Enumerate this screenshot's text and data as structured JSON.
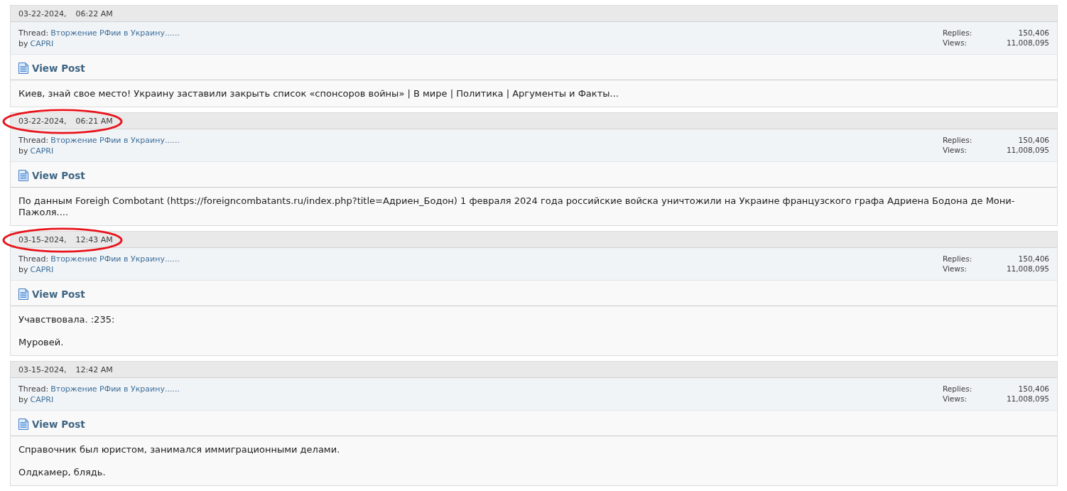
{
  "posts": [
    {
      "date": "03-22-2024,",
      "time": "06:22 AM",
      "circled": false,
      "thread_label": "Thread:",
      "thread_title": "Вторжение РФии в Украину......",
      "by_label": "by",
      "author": "CAPRI",
      "stats": [
        {
          "label": "Replies:",
          "value": "150,406"
        },
        {
          "label": "Views:",
          "value": "11,008,095"
        }
      ],
      "view_post": "View Post",
      "body": [
        "Киев, знай свое место! Украину заставили закрыть список «спонсоров войны» | В мире | Политика | Аргументы и Факты..."
      ]
    },
    {
      "date": "03-22-2024,",
      "time": "06:21 AM",
      "circled": true,
      "thread_label": "Thread:",
      "thread_title": "Вторжение РФии в Украину......",
      "by_label": "by",
      "author": "CAPRI",
      "stats": [
        {
          "label": "Replies:",
          "value": "150,406"
        },
        {
          "label": "Views:",
          "value": "11,008,095"
        }
      ],
      "view_post": "View Post",
      "body": [
        "По данным Foreigh Combotant (https://foreigncombatants.ru/index.php?title=Адриен_Бодон) 1 февраля 2024 года российские войска уничтожили на Украине французского графа Адриена Бодона де Мони-Пажоля...."
      ]
    },
    {
      "date": "03-15-2024,",
      "time": "12:43 AM",
      "circled": true,
      "thread_label": "Thread:",
      "thread_title": "Вторжение РФии в Украину......",
      "by_label": "by",
      "author": "CAPRI",
      "stats": [
        {
          "label": "Replies:",
          "value": "150,406"
        },
        {
          "label": "Views:",
          "value": "11,008,095"
        }
      ],
      "view_post": "View Post",
      "body": [
        "Учавствовала. :235:",
        "Муровей."
      ]
    },
    {
      "date": "03-15-2024,",
      "time": "12:42 AM",
      "circled": false,
      "thread_label": "Thread:",
      "thread_title": "Вторжение РФии в Украину......",
      "by_label": "by",
      "author": "CAPRI",
      "stats": [
        {
          "label": "Replies:",
          "value": "150,406"
        },
        {
          "label": "Views:",
          "value": "11,008,095"
        }
      ],
      "view_post": "View Post",
      "body": [
        "Справочник был юристом, занимался иммиграционными делами.",
        "Олдкамер, блядь."
      ]
    }
  ]
}
